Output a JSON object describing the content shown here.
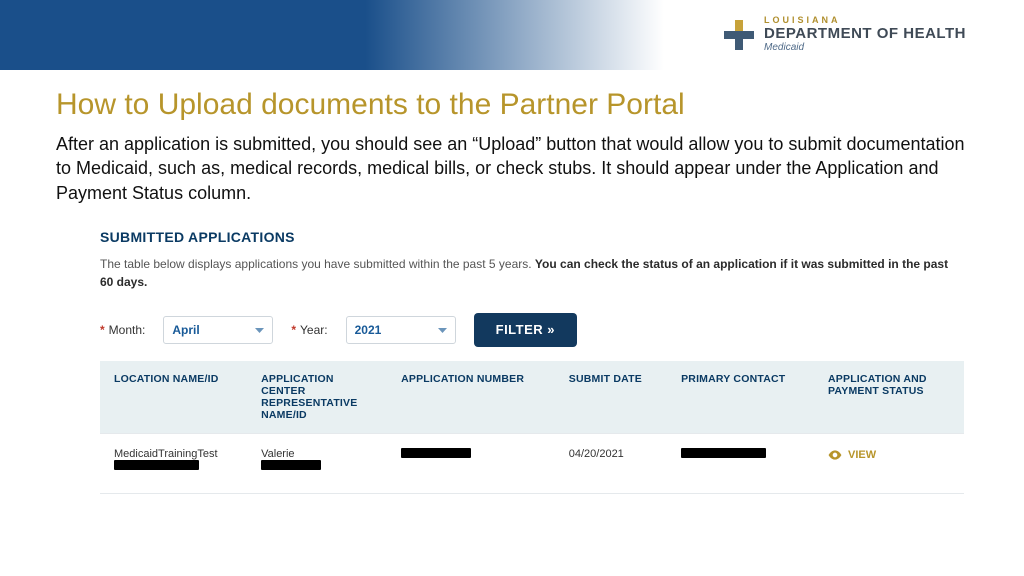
{
  "logo": {
    "line1": "LOUISIANA",
    "line2": "DEPARTMENT OF HEALTH",
    "line3": "Medicaid"
  },
  "page": {
    "title": "How to Upload documents to the Partner Portal",
    "intro": "After an application is submitted, you should see an “Upload” button that would allow you to submit documentation to Medicaid, such as, medical records, medical bills, or check stubs. It should appear under the Application and Payment Status column."
  },
  "panel": {
    "heading": "SUBMITTED APPLICATIONS",
    "desc_plain": "The table below displays applications you have submitted within the past 5 years. ",
    "desc_bold": "You can check the status of an application if it was submitted in the past 60 days."
  },
  "filter": {
    "month_label": "Month:",
    "month_value": "April",
    "year_label": "Year:",
    "year_value": "2021",
    "button": "FILTER »"
  },
  "table": {
    "headers": {
      "location": "LOCATION NAME/ID",
      "rep": "APPLICATION CENTER REPRESENTATIVE NAME/ID",
      "appnum": "APPLICATION NUMBER",
      "submit": "SUBMIT DATE",
      "contact": "PRIMARY CONTACT",
      "status": "APPLICATION AND PAYMENT STATUS"
    },
    "rows": [
      {
        "location": "MedicaidTrainingTest",
        "rep": "Valerie",
        "submit_date": "04/20/2021",
        "status_action": "VIEW"
      }
    ]
  }
}
